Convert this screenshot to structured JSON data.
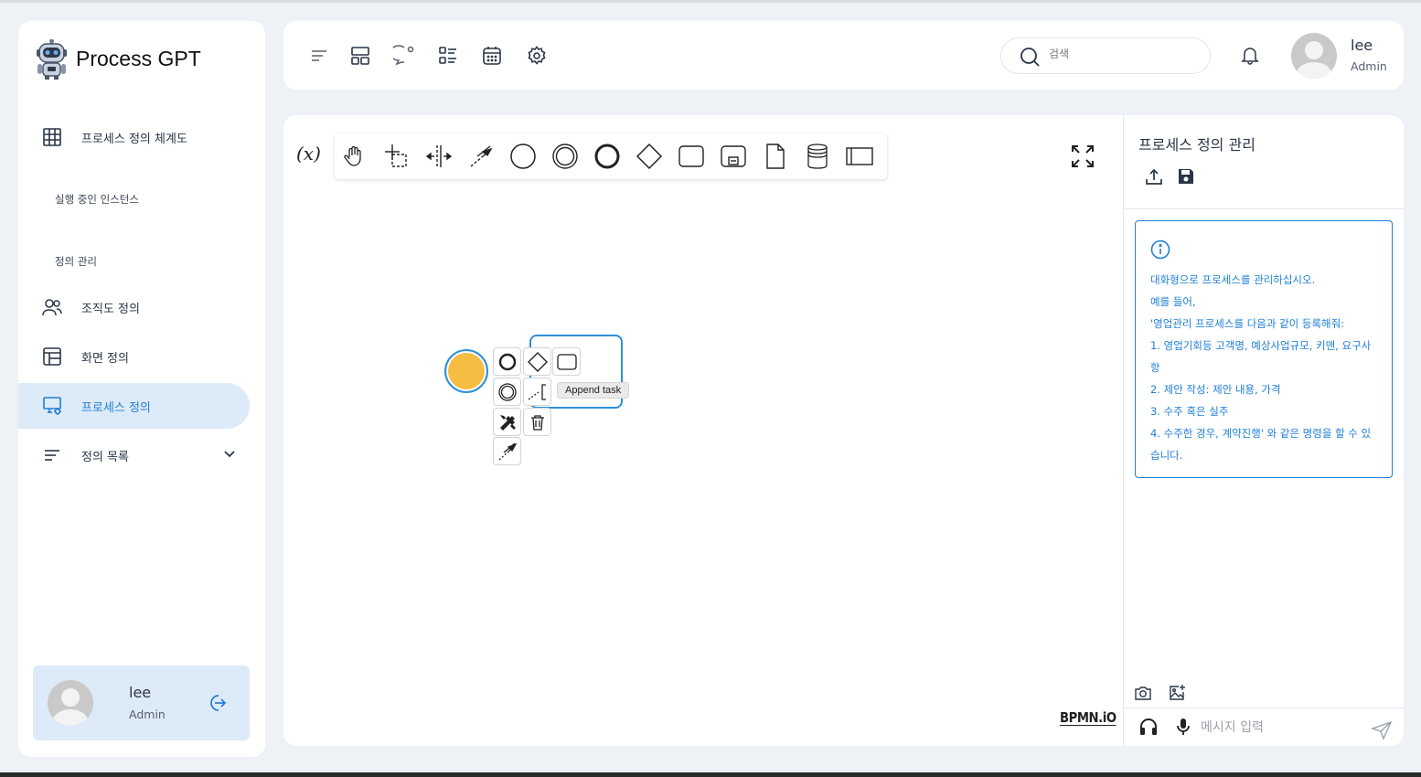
{
  "app": {
    "title": "Process GPT"
  },
  "sidebar": {
    "items": [
      {
        "label": "프로세스 정의 체계도",
        "icon": "grid-icon"
      },
      {
        "label": "실행 중인 인스턴스"
      },
      {
        "label": "정의 관리"
      },
      {
        "label": "조직도 정의",
        "icon": "users-icon"
      },
      {
        "label": "화면 정의",
        "icon": "layout-icon"
      },
      {
        "label": "프로세스 정의",
        "icon": "process-settings-icon",
        "active": true
      },
      {
        "label": "정의 목록",
        "icon": "list-icon"
      }
    ],
    "user": {
      "name": "lee",
      "role": "Admin"
    }
  },
  "header": {
    "search": {
      "placeholder": "검색"
    },
    "user": {
      "name": "lee",
      "role": "Admin"
    }
  },
  "canvas": {
    "variables_label": "(x)",
    "tooltip": "Append task",
    "watermark": "BPMN.iO"
  },
  "panel": {
    "title": "프로세스 정의 관리",
    "info_lines": [
      "대화형으로 프로세스를 관리하십시오.",
      "예를 들어,",
      "'영업관리 프로세스를 다음과 같이 등록해줘:",
      "1. 영업기회등 고객명, 예상사업규모, 키맨, 요구사항",
      "2. 제안 작성: 제안 내용, 가격",
      "3. 수주 혹은 실주",
      "4. 수주한 경우, 계약진행' 와 같은 명령을 할 수 있습니다."
    ],
    "chat": {
      "placeholder": "메시지 입력"
    }
  },
  "colors": {
    "accent": "#1f7fd6",
    "active_bg": "#ddeaf8",
    "start_event": "#f5bd42",
    "selection": "#2f8fd8"
  }
}
